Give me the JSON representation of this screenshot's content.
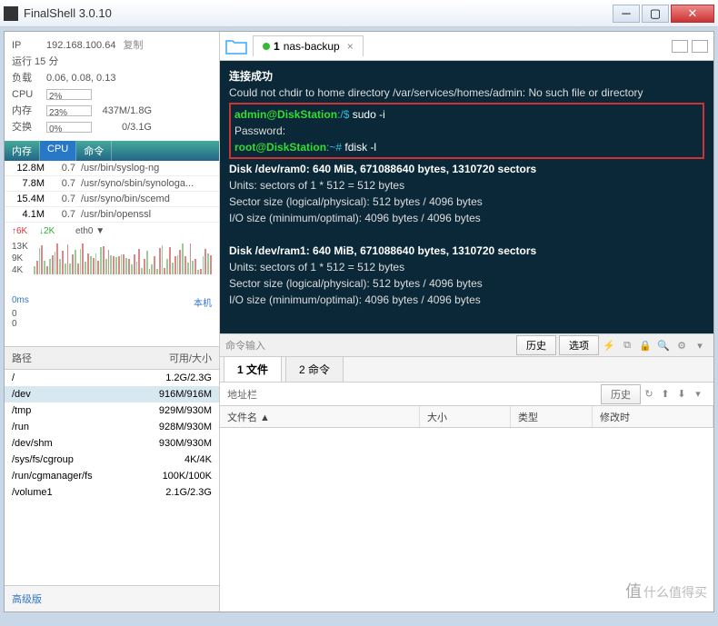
{
  "window": {
    "title": "FinalShell 3.0.10"
  },
  "info": {
    "ip_label": "IP",
    "ip": "192.168.100.64",
    "copy": "复制",
    "uptime": "运行 15 分",
    "load_lbl": "负载",
    "load": "0.06, 0.08, 0.13",
    "cpu_lbl": "CPU",
    "cpu_pct": "2%",
    "mem_lbl": "内存",
    "mem_pct": "23%",
    "mem_use": "437M/1.8G",
    "swap_lbl": "交换",
    "swap_pct": "0%",
    "swap_use": "0/3.1G"
  },
  "proc_tabs": {
    "mem": "内存",
    "cpu": "CPU",
    "cmd": "命令"
  },
  "procs": [
    {
      "mem": "12.8M",
      "cpu": "0.7",
      "cmd": "/usr/bin/syslog-ng"
    },
    {
      "mem": "7.8M",
      "cpu": "0.7",
      "cmd": "/usr/syno/sbin/synologa..."
    },
    {
      "mem": "15.4M",
      "cpu": "0.7",
      "cmd": "/usr/syno/bin/scemd"
    },
    {
      "mem": "4.1M",
      "cpu": "0.7",
      "cmd": "/usr/bin/openssl"
    }
  ],
  "net": {
    "up": "↑6K",
    "down": "↓2K",
    "if": "eth0 ▼",
    "y1": "13K",
    "y2": "9K",
    "y3": "4K"
  },
  "lat": {
    "t": "0ms",
    "host": "本机",
    "y1": "0",
    "y2": "0"
  },
  "paths": {
    "h1": "路径",
    "h2": "可用/大小",
    "rows": [
      {
        "p": "/",
        "s": "1.2G/2.3G"
      },
      {
        "p": "/dev",
        "s": "916M/916M"
      },
      {
        "p": "/tmp",
        "s": "929M/930M"
      },
      {
        "p": "/run",
        "s": "928M/930M"
      },
      {
        "p": "/dev/shm",
        "s": "930M/930M"
      },
      {
        "p": "/sys/fs/cgroup",
        "s": "4K/4K"
      },
      {
        "p": "/run/cgmanager/fs",
        "s": "100K/100K"
      },
      {
        "p": "/volume1",
        "s": "2.1G/2.3G"
      }
    ]
  },
  "foot": "高级版",
  "rtab": {
    "num": "1",
    "name": "nas-backup"
  },
  "term": {
    "ok": "连接成功",
    "l1": "Could not chdir to home directory /var/services/homes/admin: No such file or directory",
    "u1": "admin@DiskStation",
    "p1": ":/$",
    "c1": " sudo -i",
    "pw": "Password:",
    "u2": "root@DiskStation",
    "p2": ":~#",
    "c2": " fdisk -l",
    "d1h": "Disk /dev/ram0: 640 MiB, 671088640 bytes, 1310720 sectors",
    "d1a": "Units: sectors of 1 * 512 = 512 bytes",
    "d1b": "Sector size (logical/physical): 512 bytes / 4096 bytes",
    "d1c": "I/O size (minimum/optimal): 4096 bytes / 4096 bytes",
    "d2h": "Disk /dev/ram1: 640 MiB, 671088640 bytes, 1310720 sectors",
    "d2a": "Units: sectors of 1 * 512 = 512 bytes",
    "d2b": "Sector size (logical/physical): 512 bytes / 4096 bytes",
    "d2c": "I/O size (minimum/optimal): 4096 bytes / 4096 bytes"
  },
  "cmdbar": {
    "lbl": "命令输入",
    "history": "历史",
    "options": "选项"
  },
  "btabs": {
    "t1": "1 文件",
    "t2": "2 命令"
  },
  "addr": {
    "lbl": "地址栏",
    "history": "历史"
  },
  "filehdr": {
    "c1": "文件名 ▲",
    "c2": "大小",
    "c3": "类型",
    "c4": "修改时"
  },
  "watermark": "什么值得买"
}
